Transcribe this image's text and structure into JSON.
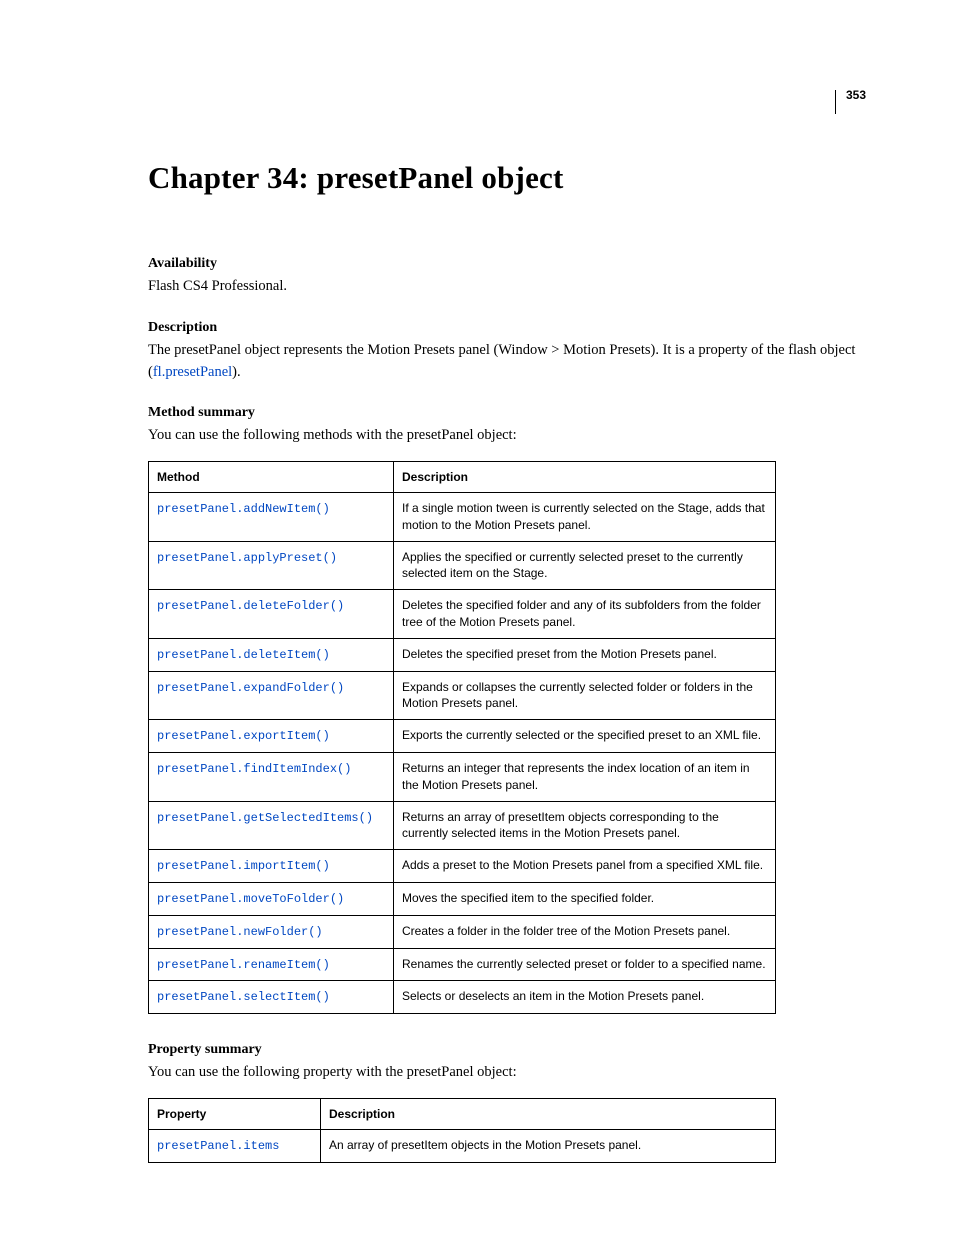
{
  "page_number": "353",
  "chapter_title": "Chapter 34: presetPanel object",
  "sections": {
    "availability": {
      "heading": "Availability",
      "body": "Flash CS4 Professional."
    },
    "description": {
      "heading": "Description",
      "body_pre": "The presetPanel object represents the Motion Presets panel (Window > Motion Presets). It is a property of the flash object (",
      "link": "fl.presetPanel",
      "body_post": ")."
    },
    "method_summary": {
      "heading": "Method summary",
      "intro": "You can use the following methods with the presetPanel object:",
      "col_method": "Method",
      "col_desc": "Description",
      "rows": [
        {
          "m": "presetPanel.addNewItem()",
          "d": "If a single motion tween is currently selected on the Stage, adds that motion to the Motion Presets panel."
        },
        {
          "m": "presetPanel.applyPreset()",
          "d": "Applies the specified or currently selected preset to the currently selected item on the Stage."
        },
        {
          "m": "presetPanel.deleteFolder()",
          "d": "Deletes the specified folder and any of its subfolders from the folder tree of the Motion Presets panel."
        },
        {
          "m": "presetPanel.deleteItem()",
          "d": "Deletes the specified preset from the Motion Presets panel."
        },
        {
          "m": "presetPanel.expandFolder()",
          "d": "Expands or collapses the currently selected folder or folders in the Motion Presets panel."
        },
        {
          "m": "presetPanel.exportItem()",
          "d": "Exports the currently selected or the specified preset to an XML file."
        },
        {
          "m": "presetPanel.findItemIndex()",
          "d": "Returns an integer that represents the index location of an item in the Motion Presets panel."
        },
        {
          "m": "presetPanel.getSelectedItems()",
          "d": "Returns an array of presetItem objects corresponding to the currently selected items in the Motion Presets panel."
        },
        {
          "m": "presetPanel.importItem()",
          "d": "Adds a preset to the Motion Presets panel from a specified XML file."
        },
        {
          "m": "presetPanel.moveToFolder()",
          "d": "Moves the specified item to the specified folder."
        },
        {
          "m": "presetPanel.newFolder()",
          "d": "Creates a folder in the folder tree of the Motion Presets panel."
        },
        {
          "m": "presetPanel.renameItem()",
          "d": "Renames the currently selected preset or folder to a specified name."
        },
        {
          "m": "presetPanel.selectItem()",
          "d": "Selects or deselects an item in the Motion Presets panel."
        }
      ]
    },
    "property_summary": {
      "heading": "Property summary",
      "intro": "You can use the following property with the presetPanel object:",
      "col_prop": "Property",
      "col_desc": "Description",
      "rows": [
        {
          "m": "presetPanel.items",
          "d": "An array of presetItem objects in the Motion Presets panel."
        }
      ]
    }
  }
}
